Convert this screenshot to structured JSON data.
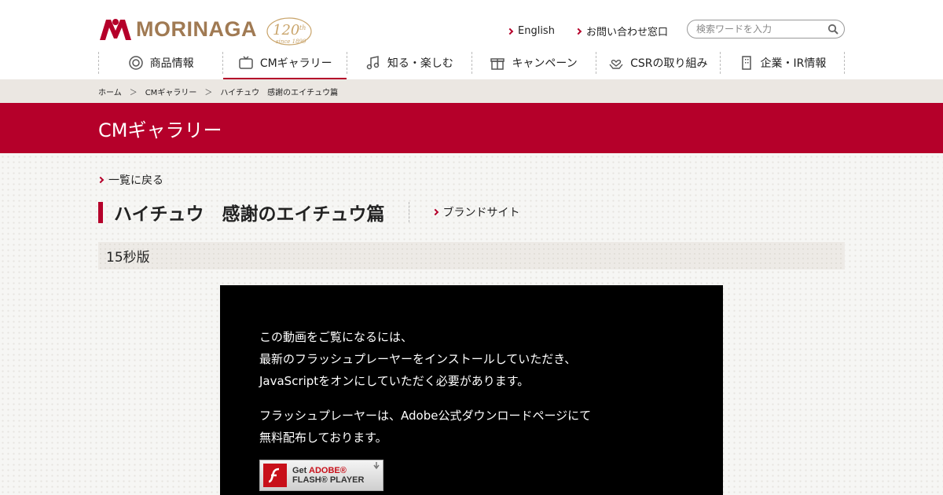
{
  "brand": {
    "logo_text": "MORINAGA",
    "anniversary": "120th",
    "since": "since 1899",
    "accent_color": "#b5002a",
    "logo_color": "#a07a53"
  },
  "header": {
    "links": [
      {
        "label": "English",
        "icon": "chevron-right-icon"
      },
      {
        "label": "お問い合わせ窓口",
        "icon": "chevron-right-icon"
      }
    ],
    "search": {
      "placeholder": "検索ワードを入力",
      "value": "",
      "icon": "search-icon"
    }
  },
  "nav": [
    {
      "label": "商品情報",
      "icon": "product-icon",
      "active": false
    },
    {
      "label": "CMギャラリー",
      "icon": "tv-icon",
      "active": true
    },
    {
      "label": "知る・楽しむ",
      "icon": "music-note-icon",
      "active": false
    },
    {
      "label": "キャンペーン",
      "icon": "gift-icon",
      "active": false
    },
    {
      "label": "CSRの取り組み",
      "icon": "heart-hands-icon",
      "active": false
    },
    {
      "label": "企業・IR情報",
      "icon": "building-icon",
      "active": false
    }
  ],
  "breadcrumb": {
    "items": [
      "ホーム",
      "CMギャラリー",
      "ハイチュウ　感謝のエイチュウ篇"
    ],
    "separator": "＞"
  },
  "banner": {
    "title": "CMギャラリー"
  },
  "content": {
    "back_label": "一覧に戻る",
    "title": "ハイチュウ　感謝のエイチュウ篇",
    "brand_link": "ブランドサイト",
    "section_label": "15秒版"
  },
  "player": {
    "message_lines_1": [
      "この動画をご覧になるには、",
      "最新のフラッシュプレーヤーをインストールしていただき、",
      "JavaScriptをオンにしていただく必要があります。"
    ],
    "message_lines_2": [
      "フラッシュプレーヤーは、Adobe公式ダウンロードページにて",
      "無料配布しております。"
    ],
    "flash_button": {
      "line1_prefix": "Get ",
      "line1_brand": "ADOBE®",
      "line2": "FLASH® PLAYER"
    }
  }
}
